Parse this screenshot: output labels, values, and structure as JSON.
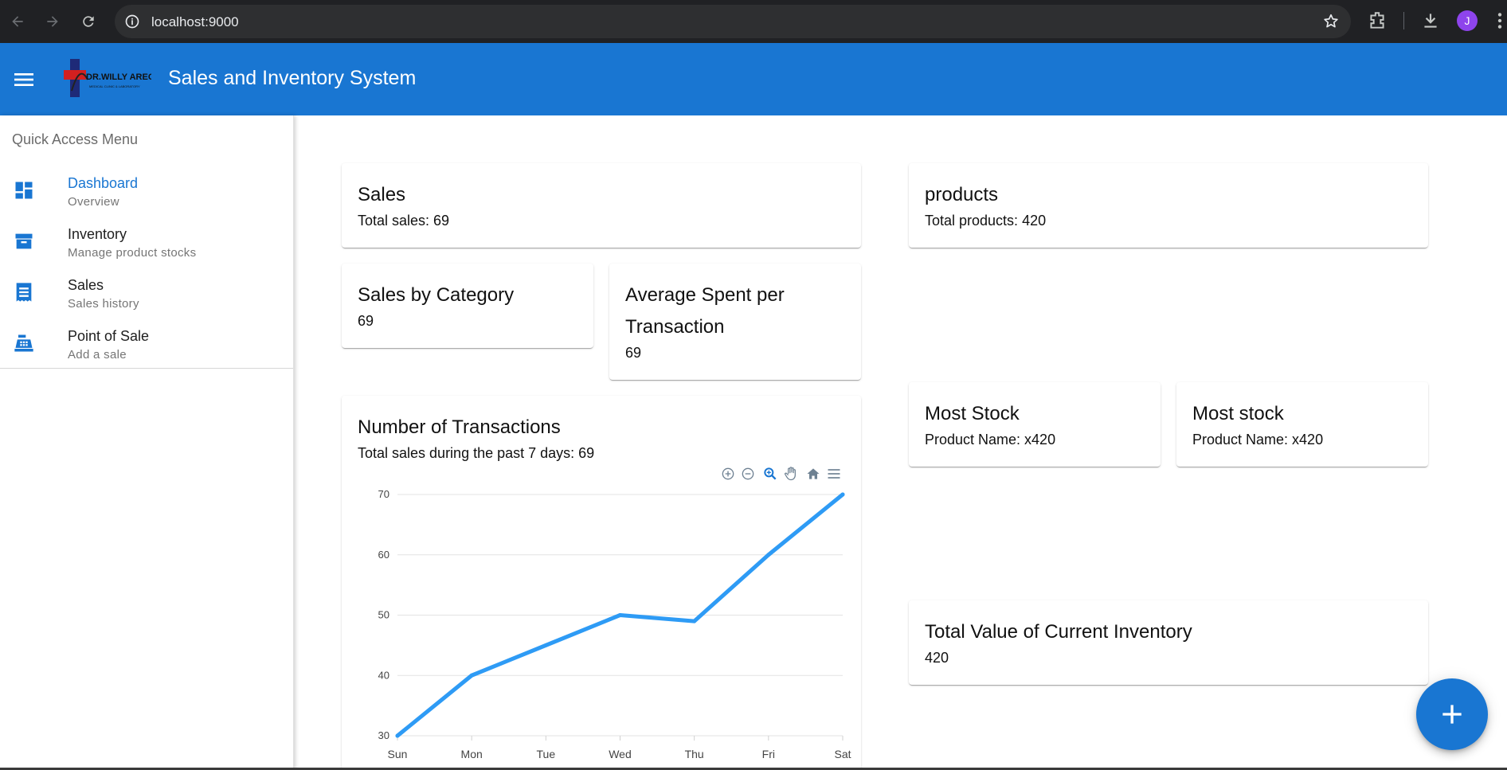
{
  "browser": {
    "url": "localhost:9000",
    "profile_initial": "J"
  },
  "app": {
    "title": "Sales and Inventory System",
    "logo_text": "DR.WILLY AREOLA",
    "logo_subtext": "MEDICAL CLINIC & LABORATORY",
    "accent_color": "#1976d2"
  },
  "sidebar": {
    "header": "Quick Access Menu",
    "items": [
      {
        "label": "Dashboard",
        "sub": "Overview",
        "icon": "dashboard-icon",
        "active": true
      },
      {
        "label": "Inventory",
        "sub": "Manage product stocks",
        "icon": "archive-icon",
        "active": false
      },
      {
        "label": "Sales",
        "sub": "Sales history",
        "icon": "receipt-icon",
        "active": false
      },
      {
        "label": "Point of Sale",
        "sub": "Add a sale",
        "icon": "cash-register-icon",
        "active": false
      }
    ]
  },
  "cards": {
    "sales": {
      "title": "Sales",
      "value": "Total sales: 69"
    },
    "products": {
      "title": "products",
      "value": "Total products: 420"
    },
    "sales_by_category": {
      "title": "Sales by Category",
      "value": "69"
    },
    "avg_spent": {
      "title_line1": "Average Spent per",
      "title_line2": "Transaction",
      "value": "69"
    },
    "transactions": {
      "title": "Number of Transactions",
      "value": "Total sales during the past 7 days: 69"
    },
    "most_stock_1": {
      "title": "Most Stock",
      "value": "Product Name: x420"
    },
    "most_stock_2": {
      "title": "Most stock",
      "value": "Product Name: x420"
    },
    "inventory_value": {
      "title": "Total Value of Current Inventory",
      "value": "420"
    }
  },
  "chart_data": {
    "type": "line",
    "categories": [
      "Sun",
      "Mon",
      "Tue",
      "Wed",
      "Thu",
      "Fri",
      "Sat"
    ],
    "values": [
      30,
      40,
      45,
      50,
      49,
      60,
      70
    ],
    "ylim": [
      30,
      70
    ],
    "yticks": [
      30,
      40,
      50,
      60,
      70
    ],
    "title": "",
    "xlabel": "",
    "ylabel": "",
    "grid": true,
    "line_color": "#2e9bf5"
  }
}
